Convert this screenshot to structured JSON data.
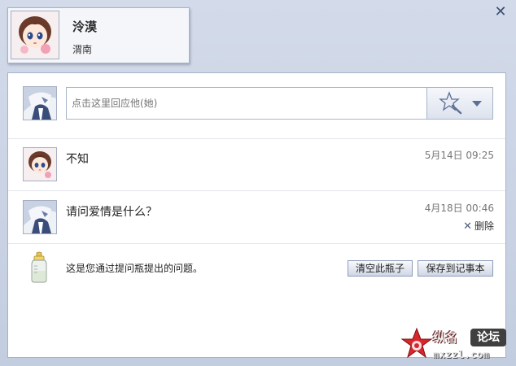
{
  "window": {
    "close_icon": "close-icon"
  },
  "profile": {
    "name": "泠漠",
    "location": "渭南",
    "avatar_icon": "girl-avatar-icon"
  },
  "reply": {
    "placeholder": "点击这里回应他(她)",
    "emoji_icon": "magic-wand-icon",
    "dropdown_icon": "chevron-down-icon"
  },
  "messages": [
    {
      "text": "不知",
      "time": "5月14日 09:25",
      "avatar_icon": "girl-avatar-icon"
    },
    {
      "text": "请问爱情是什么？",
      "time": "4月18日 00:46",
      "avatar_icon": "boy-avatar-icon",
      "delete_label": "删除"
    }
  ],
  "bottle": {
    "text": "这是您通过提问瓶提出的问题。",
    "clear_label": "清空此瓶子",
    "save_label": "保存到记事本",
    "icon": "baby-bottle-icon"
  },
  "watermark": {
    "top": "纵名",
    "forum": "论坛",
    "url": "mxzzl.com"
  },
  "colors": {
    "accent": "#3d4f72",
    "panel_border": "#a7b2c8",
    "background": "#c6d0e2"
  }
}
